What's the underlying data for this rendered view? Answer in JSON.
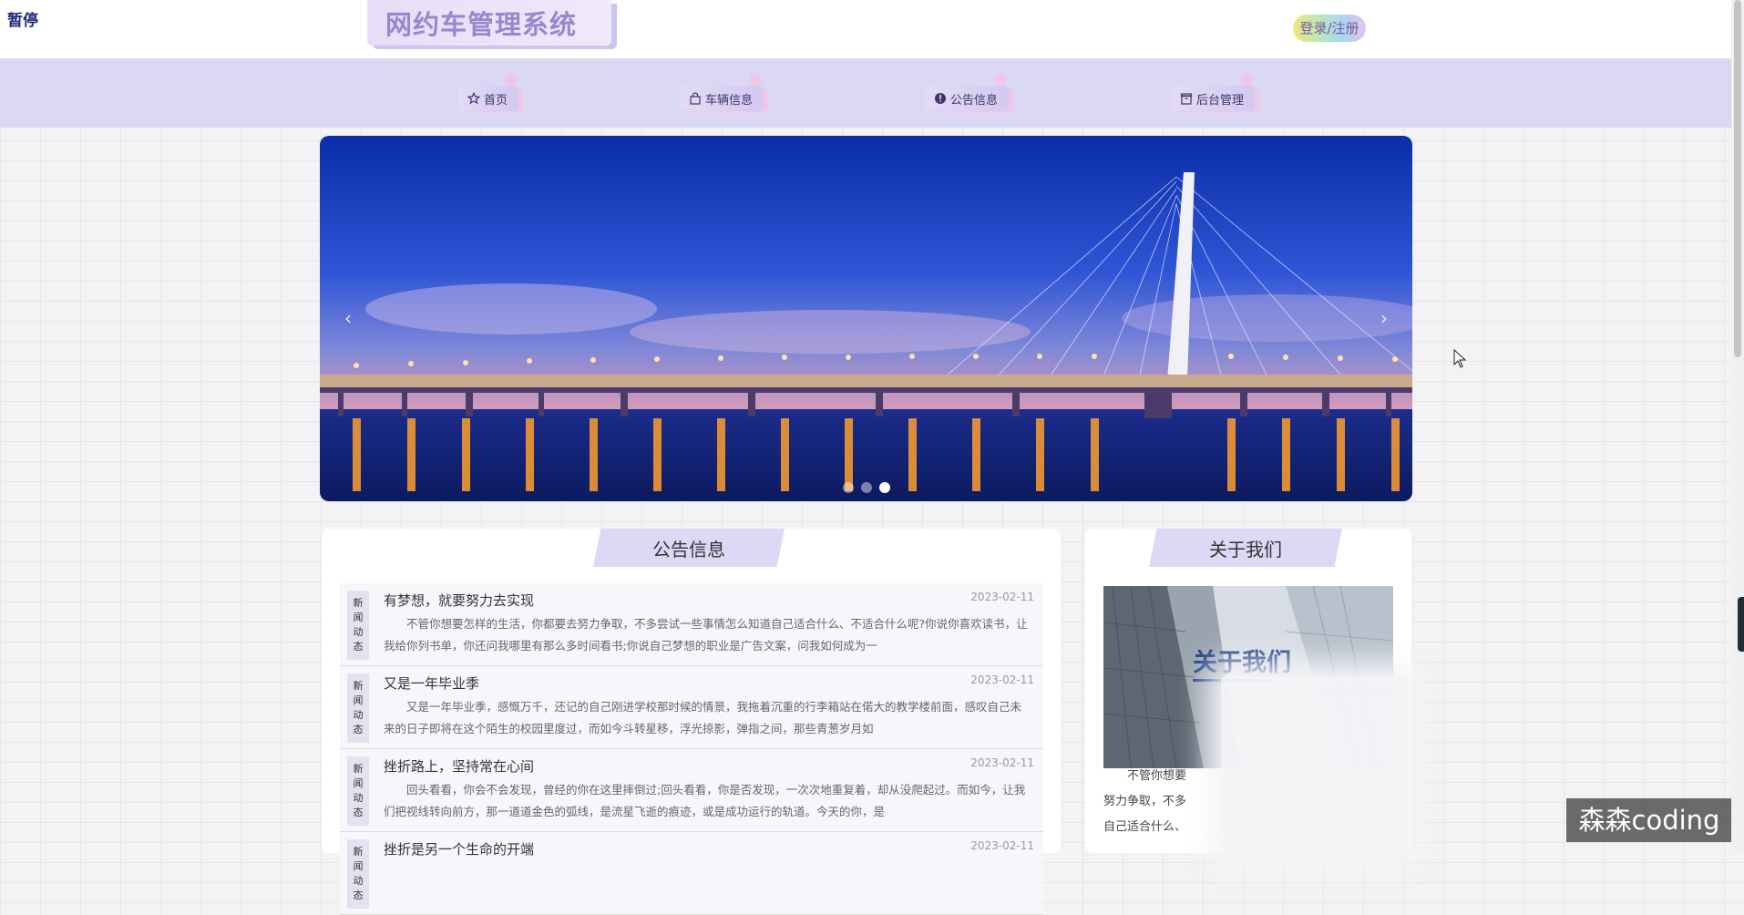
{
  "overlay": {
    "pause_label": "暂停",
    "watermark": "森森coding"
  },
  "header": {
    "brand_title": "网约车管理系统",
    "login_label": "登录/注册"
  },
  "nav": {
    "items": [
      {
        "label": "首页",
        "icon": "star-icon"
      },
      {
        "label": "车辆信息",
        "icon": "bag-icon"
      },
      {
        "label": "公告信息",
        "icon": "info-icon"
      },
      {
        "label": "后台管理",
        "icon": "archive-icon"
      }
    ]
  },
  "carousel": {
    "prev": "‹",
    "next": "›",
    "slide_count": 3,
    "active_index": 2
  },
  "notice": {
    "heading": "公告信息",
    "items": [
      {
        "tag": [
          "新",
          "闻",
          "动",
          "态"
        ],
        "title": "有梦想，就要努力去实现",
        "date": "2023-02-11",
        "body": "不管你想要怎样的生活，你都要去努力争取，不多尝试一些事情怎么知道自己适合什么、不适合什么呢?你说你喜欢读书，让我给你列书单，你还问我哪里有那么多时间看书;你说自己梦想的职业是广告文案，问我如何成为一"
      },
      {
        "tag": [
          "新",
          "闻",
          "动",
          "态"
        ],
        "title": "又是一年毕业季",
        "date": "2023-02-11",
        "body": "又是一年毕业季，感慨万千，还记的自己刚进学校那时候的情景，我拖着沉重的行李箱站在偌大的教学楼前面，感叹自己未来的日子即将在这个陌生的校园里度过，而如今斗转星移，浮光掠影，弹指之间，那些青葱岁月如"
      },
      {
        "tag": [
          "新",
          "闻",
          "动",
          "态"
        ],
        "title": "挫折路上，坚持常在心间",
        "date": "2023-02-11",
        "body": "回头看看，你会不会发现，曾经的你在这里摔倒过;回头看看，你是否发现，一次次地重复着，却从没爬起过。而如今，让我们把视线转向前方，那一道道金色的弧线，是流星飞逝的痕迹，或是成功运行的轨道。今天的你，是"
      },
      {
        "tag": [
          "新",
          "闻",
          "动",
          "态"
        ],
        "title": "挫折是另一个生命的开端",
        "date": "2023-02-11",
        "body": ""
      }
    ]
  },
  "about": {
    "heading": "关于我们",
    "image_title": "关于我们",
    "lines": [
      "不管你想要",
      "努力争取，不多",
      "自己适合什么、"
    ]
  }
}
